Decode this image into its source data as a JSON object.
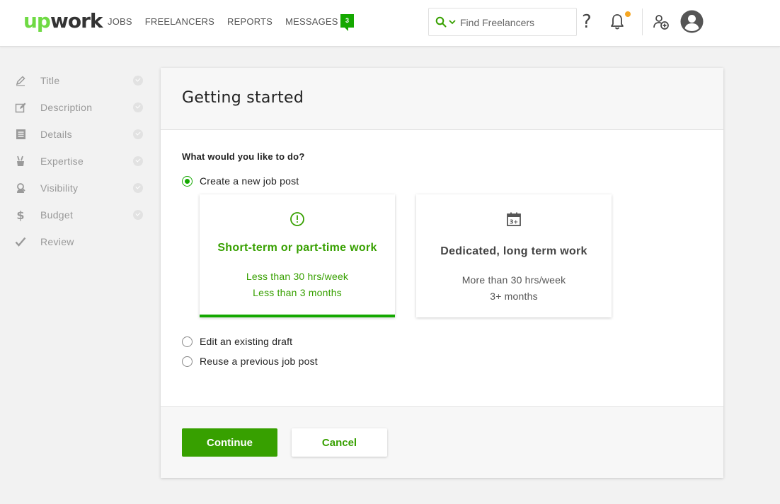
{
  "header": {
    "logo_up": "up",
    "logo_work": "work",
    "nav": [
      "JOBS",
      "FREELANCERS",
      "REPORTS",
      "MESSAGES"
    ],
    "messages_badge": "3",
    "search_placeholder": "Find Freelancers",
    "help_label": "?",
    "notification_dot_color": "#f5a623"
  },
  "sidebar": {
    "items": [
      {
        "label": "Title",
        "icon": "pencil-icon",
        "done": true
      },
      {
        "label": "Description",
        "icon": "edit-icon",
        "done": true
      },
      {
        "label": "Details",
        "icon": "list-icon",
        "done": true
      },
      {
        "label": "Expertise",
        "icon": "tools-icon",
        "done": true
      },
      {
        "label": "Visibility",
        "icon": "person-search-icon",
        "done": true
      },
      {
        "label": "Budget",
        "icon": "dollar-icon",
        "done": true
      },
      {
        "label": "Review",
        "icon": "checkmark-icon",
        "done": false
      }
    ]
  },
  "main": {
    "title": "Getting started",
    "question": "What would you like to do?",
    "options": {
      "create_new": "Create a new job post",
      "edit_draft": "Edit an existing draft",
      "reuse": "Reuse a previous job post"
    },
    "selected_option": "create_new",
    "job_types": [
      {
        "title": "Short-term or part-time work",
        "line1": "Less than 30 hrs/week",
        "line2": "Less than 3 months",
        "icon": "clock-icon",
        "selected": true
      },
      {
        "title": "Dedicated, long term work",
        "line1": "More than 30 hrs/week",
        "line2": "3+ months",
        "icon": "calendar-icon",
        "selected": false
      }
    ]
  },
  "footer": {
    "continue_label": "Continue",
    "cancel_label": "Cancel"
  },
  "colors": {
    "brand_green": "#37a000",
    "logo_green": "#6fda44",
    "badge_green": "#14a800"
  }
}
